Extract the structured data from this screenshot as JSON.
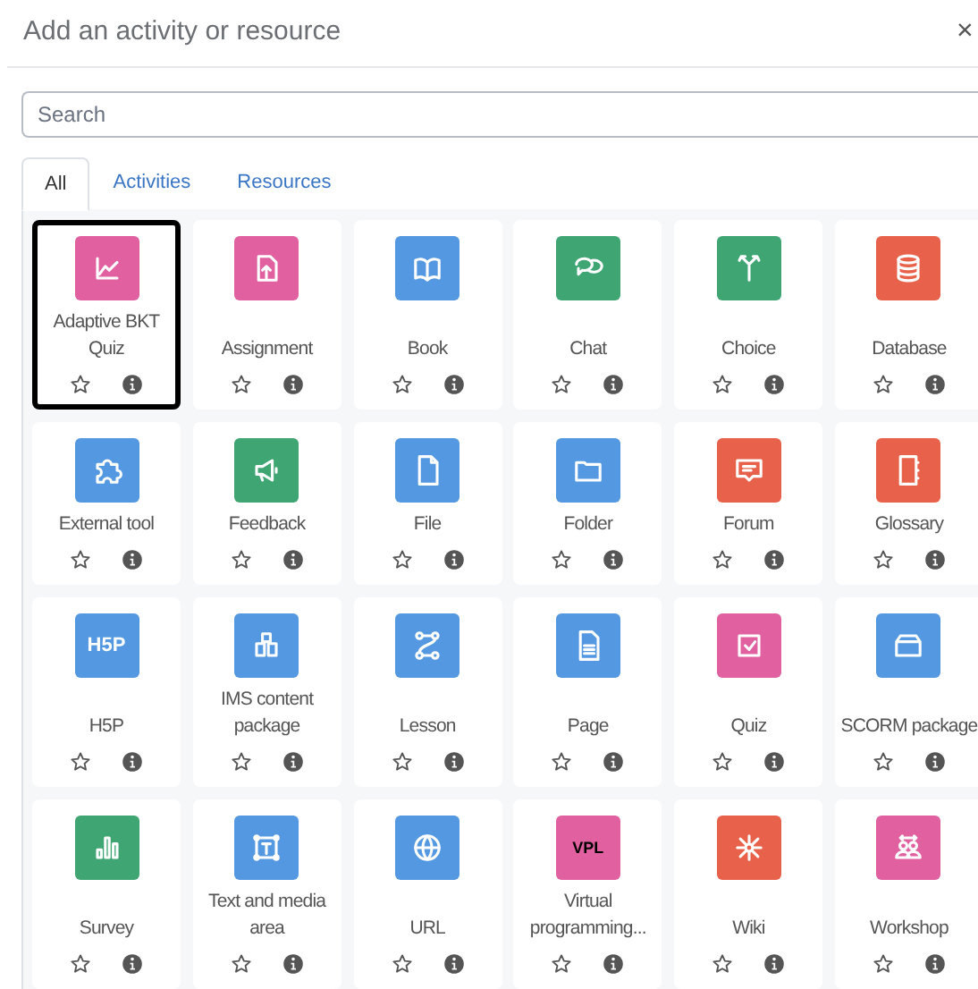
{
  "dialog": {
    "title": "Add an activity or resource",
    "close": "×"
  },
  "search": {
    "placeholder": "Search"
  },
  "tabs": [
    {
      "label": "All",
      "selected": true
    },
    {
      "label": "Activities",
      "selected": false
    },
    {
      "label": "Resources",
      "selected": false
    }
  ],
  "items": [
    {
      "name": "Adaptive BKT Quiz",
      "color": "#e060a0",
      "selected": true
    },
    {
      "name": "Assignment",
      "color": "#e060a0",
      "selected": false
    },
    {
      "name": "Book",
      "color": "#5498e2",
      "selected": false
    },
    {
      "name": "Chat",
      "color": "#3fa573",
      "selected": false
    },
    {
      "name": "Choice",
      "color": "#3fa573",
      "selected": false
    },
    {
      "name": "Database",
      "color": "#e8614a",
      "selected": false
    },
    {
      "name": "External tool",
      "color": "#5498e2",
      "selected": false
    },
    {
      "name": "Feedback",
      "color": "#3fa573",
      "selected": false
    },
    {
      "name": "File",
      "color": "#5498e2",
      "selected": false
    },
    {
      "name": "Folder",
      "color": "#5498e2",
      "selected": false
    },
    {
      "name": "Forum",
      "color": "#e8614a",
      "selected": false
    },
    {
      "name": "Glossary",
      "color": "#e8614a",
      "selected": false
    },
    {
      "name": "H5P",
      "color": "#5498e2",
      "selected": false,
      "icon_text": "H5P"
    },
    {
      "name": "IMS content package",
      "color": "#5498e2",
      "selected": false
    },
    {
      "name": "Lesson",
      "color": "#5498e2",
      "selected": false
    },
    {
      "name": "Page",
      "color": "#5498e2",
      "selected": false
    },
    {
      "name": "Quiz",
      "color": "#e060a0",
      "selected": false
    },
    {
      "name": "SCORM package",
      "color": "#5498e2",
      "selected": false
    },
    {
      "name": "Survey",
      "color": "#3fa573",
      "selected": false
    },
    {
      "name": "Text and media area",
      "color": "#5498e2",
      "selected": false
    },
    {
      "name": "URL",
      "color": "#5498e2",
      "selected": false
    },
    {
      "name": "Virtual programming...",
      "color": "#e060a0",
      "selected": false,
      "icon_text": "VPL"
    },
    {
      "name": "Wiki",
      "color": "#e8614a",
      "selected": false
    },
    {
      "name": "Workshop",
      "color": "#e060a0",
      "selected": false
    }
  ]
}
